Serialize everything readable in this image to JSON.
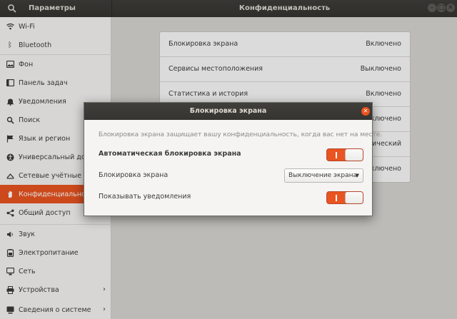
{
  "header": {
    "app_title": "Параметры",
    "page_title": "Конфиденциальность",
    "icons": [
      "search-icon",
      "minimize-icon",
      "maximize-icon",
      "close-icon"
    ]
  },
  "sidebar": {
    "items": [
      {
        "label": "Wi-Fi",
        "icon": "wifi-icon"
      },
      {
        "label": "Bluetooth",
        "icon": "bluetooth-icon"
      },
      {
        "label": "Фон",
        "icon": "background-icon"
      },
      {
        "label": "Панель задач",
        "icon": "dock-icon"
      },
      {
        "label": "Уведомления",
        "icon": "bell-icon"
      },
      {
        "label": "Поиск",
        "icon": "search-icon"
      },
      {
        "label": "Язык и регион",
        "icon": "flag-icon"
      },
      {
        "label": "Универсальный доступ",
        "icon": "accessibility-icon"
      },
      {
        "label": "Сетевые учётные записи",
        "icon": "cloud-icon"
      },
      {
        "label": "Конфиденциальность",
        "icon": "hand-icon",
        "active": true
      },
      {
        "label": "Общий доступ",
        "icon": "share-icon"
      },
      {
        "label": "Звук",
        "icon": "speaker-icon"
      },
      {
        "label": "Электропитание",
        "icon": "battery-icon"
      },
      {
        "label": "Сеть",
        "icon": "network-icon"
      },
      {
        "label": "Устройства",
        "icon": "printer-icon",
        "chevron": true
      },
      {
        "label": "Сведения о системе",
        "icon": "info-icon",
        "chevron": true
      }
    ]
  },
  "privacy_list": [
    {
      "name": "Блокировка экрана",
      "value": "Включено"
    },
    {
      "name": "Сервисы местоположения",
      "value": "Выключено"
    },
    {
      "name": "Статистика и история",
      "value": "Включено"
    },
    {
      "name": "",
      "value": "Включено"
    },
    {
      "name": "",
      "value": "тический"
    },
    {
      "name": "",
      "value": "ключено"
    }
  ],
  "dialog": {
    "title": "Блокировка экрана",
    "description": "Блокировка экрана защищает вашу конфиденциальность, когда вас нет на месте.",
    "auto_lock_label": "Автоматическая блокировка экрана",
    "auto_lock_on": true,
    "lock_screen_label": "Блокировка экрана",
    "lock_screen_value": "Выключение экрана",
    "show_notifications_label": "Показывать уведомления",
    "show_notifications_on": true
  },
  "colors": {
    "accent": "#e95420",
    "header_bg": "#3b3a36",
    "sidebar_bg": "#f5f4f3"
  }
}
